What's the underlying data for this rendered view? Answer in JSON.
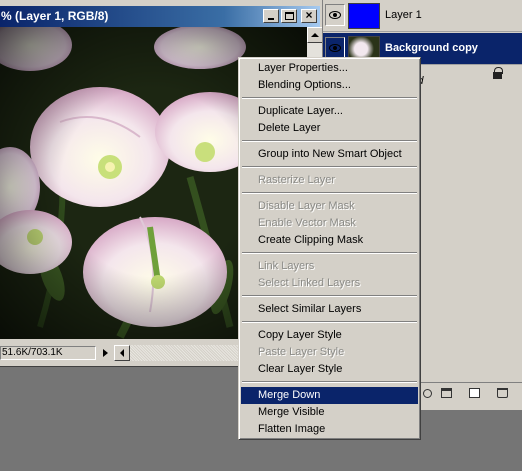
{
  "document": {
    "title": "% (Layer 1, RGB/8)",
    "doc_size": "51.6K/703.1K"
  },
  "layers": [
    {
      "name": "Layer 1",
      "thumb_color": "#0000ff",
      "selected": false
    },
    {
      "name": "Background copy",
      "selected": true
    },
    {
      "name": "ound",
      "locked": true
    }
  ],
  "context_menu": {
    "items": [
      {
        "label": "Layer Properties...",
        "enabled": true
      },
      {
        "label": "Blending Options...",
        "enabled": true
      },
      {
        "separator": true
      },
      {
        "label": "Duplicate Layer...",
        "enabled": true
      },
      {
        "label": "Delete Layer",
        "enabled": true
      },
      {
        "separator": true
      },
      {
        "label": "Group into New Smart Object",
        "enabled": true
      },
      {
        "separator": true
      },
      {
        "label": "Rasterize Layer",
        "enabled": false
      },
      {
        "separator": true
      },
      {
        "label": "Disable Layer Mask",
        "enabled": false
      },
      {
        "label": "Enable Vector Mask",
        "enabled": false
      },
      {
        "label": "Create Clipping Mask",
        "enabled": true
      },
      {
        "separator": true
      },
      {
        "label": "Link Layers",
        "enabled": false
      },
      {
        "label": "Select Linked Layers",
        "enabled": false
      },
      {
        "separator": true
      },
      {
        "label": "Select Similar Layers",
        "enabled": true
      },
      {
        "separator": true
      },
      {
        "label": "Copy Layer Style",
        "enabled": true
      },
      {
        "label": "Paste Layer Style",
        "enabled": false
      },
      {
        "label": "Clear Layer Style",
        "enabled": true
      },
      {
        "separator": true
      },
      {
        "label": "Merge Down",
        "enabled": true,
        "highlighted": true
      },
      {
        "label": "Merge Visible",
        "enabled": true
      },
      {
        "label": "Flatten Image",
        "enabled": true
      }
    ]
  },
  "colors": {
    "selection": "#0a246a",
    "title_gradient_start": "#0a246a",
    "title_gradient_end": "#a6caf0",
    "workspace": "#757575"
  }
}
